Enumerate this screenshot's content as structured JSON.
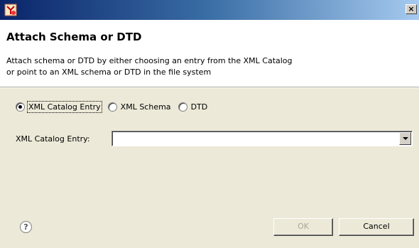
{
  "window": {
    "close_glyph": "×"
  },
  "header": {
    "title": "Attach Schema or DTD",
    "description_line1": "Attach schema or DTD by either choosing an entry from the XML Catalog",
    "description_line2": "or point to an XML schema or DTD in the file system"
  },
  "radio_group": {
    "options": [
      {
        "label": "XML Catalog Entry",
        "checked": true
      },
      {
        "label": "XML Schema",
        "checked": false
      },
      {
        "label": "DTD",
        "checked": false
      }
    ]
  },
  "catalog_entry": {
    "label": "XML Catalog Entry:",
    "value": ""
  },
  "buttons": {
    "help_glyph": "?",
    "ok_label": "OK",
    "cancel_label": "Cancel"
  },
  "icons": {
    "app_icon": "eclipse-xml-icon",
    "help_icon": "question-icon",
    "close_icon": "close-icon",
    "dropdown_icon": "chevron-down-icon"
  },
  "colors": {
    "title_bar_start": "#0a246a",
    "title_bar_end": "#a6caf0",
    "dialog_background": "#ece9d8",
    "disabled_text": "#aca899"
  }
}
